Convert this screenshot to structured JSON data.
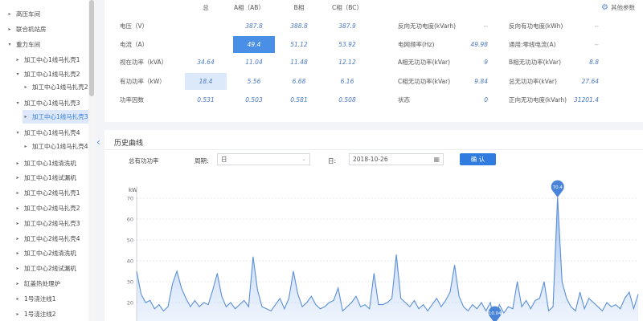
{
  "sidebar": {
    "items": [
      {
        "label": "高压车间",
        "arrow": "▸"
      },
      {
        "label": "联合机站房",
        "arrow": "▸"
      },
      {
        "label": "重力车间",
        "arrow": "▾"
      },
      {
        "label": "加工中心1线马扎壳1",
        "arrow": "▸"
      },
      {
        "label": "加工中心1线马扎壳2",
        "arrow": "▾"
      },
      {
        "label": "加工中心1线马扎壳2",
        "arrow": "▸"
      },
      {
        "label": "加工中心1线马扎壳3",
        "arrow": "▾"
      },
      {
        "label": "加工中心1线马扎壳3",
        "arrow": "▸"
      },
      {
        "label": "加工中心1线马扎壳4",
        "arrow": "▾"
      },
      {
        "label": "加工中心1线马扎壳4",
        "arrow": "▸"
      },
      {
        "label": "加工中心1线清洗机",
        "arrow": "▸"
      },
      {
        "label": "加工中心1线试漏机",
        "arrow": "▸"
      },
      {
        "label": "加工中心2线马扎壳1",
        "arrow": "▸"
      },
      {
        "label": "加工中心2线马扎壳2",
        "arrow": "▸"
      },
      {
        "label": "加工中心2线马扎壳3",
        "arrow": "▸"
      },
      {
        "label": "加工中心2线马扎壳4",
        "arrow": "▸"
      },
      {
        "label": "加工中心2线清洗机",
        "arrow": "▸"
      },
      {
        "label": "加工中心2线试漏机",
        "arrow": "▸"
      },
      {
        "label": "缸盖热处理炉",
        "arrow": "▸"
      },
      {
        "label": "1号浇注线1",
        "arrow": "▸"
      },
      {
        "label": "1号浇注线2",
        "arrow": "▸"
      }
    ]
  },
  "top": {
    "other_params": "其他参数",
    "headers": [
      "总",
      "A相（AB）",
      "B相",
      "C相（BC）"
    ],
    "rows": [
      {
        "label": "电压（V）",
        "values": [
          "",
          "387.8",
          "388.8",
          "387.9"
        ]
      },
      {
        "label": "电流（A）",
        "values": [
          "",
          "49.4",
          "51.12",
          "53.92"
        ]
      },
      {
        "label": "视在功率（kVA）",
        "values": [
          "34.64",
          "11.04",
          "11.48",
          "12.12"
        ]
      },
      {
        "label": "有功功率（kW）",
        "values": [
          "18.4",
          "5.56",
          "6.68",
          "6.16"
        ]
      },
      {
        "label": "功率因数",
        "values": [
          "0.531",
          "0.503",
          "0.581",
          "0.508"
        ]
      }
    ],
    "mid": [
      {
        "label": "反向无功电度(kVarh)",
        "value": "--"
      },
      {
        "label": "电网频率(Hz)",
        "value": "49.98"
      },
      {
        "label": "A相无功功率(kVar)",
        "value": "9"
      },
      {
        "label": "C相无功功率(kVar)",
        "value": "9.84"
      },
      {
        "label": "状态",
        "value": "0"
      }
    ],
    "right": [
      {
        "label": "反向有功电度(kWh)",
        "value": "--"
      },
      {
        "label": "通用:零线电流(A)",
        "value": "--"
      },
      {
        "label": "B相无功功率(kVar)",
        "value": "8.8"
      },
      {
        "label": "总无功功率(kVar)",
        "value": "27.64"
      },
      {
        "label": "正向无功电度(kVarh)",
        "value": "31201.4"
      }
    ]
  },
  "history": {
    "title": "历史曲线",
    "metric": "总有功功率",
    "period_label": "周期:",
    "period_value": "日",
    "date_label": "日:",
    "date_value": "2018-10-26",
    "confirm": "确 认"
  },
  "chart_data": {
    "type": "area",
    "ylabel": "kW",
    "yticks": [
      "70",
      "60",
      "50",
      "40",
      "30",
      "20"
    ],
    "ylim": [
      14,
      75
    ],
    "max_label": "70.4",
    "min_label": "10.04",
    "values": [
      35,
      24,
      20,
      21,
      17,
      19,
      16,
      18,
      29,
      35,
      27,
      22,
      18,
      21,
      18,
      20,
      19,
      26,
      34,
      23,
      18,
      20,
      17,
      19,
      21,
      18,
      42,
      26,
      18,
      17,
      16,
      19,
      22,
      17,
      22,
      35,
      24,
      18,
      20,
      23,
      19,
      17,
      18,
      20,
      21,
      27,
      16,
      18,
      20,
      23,
      18,
      19,
      17,
      34,
      19,
      19,
      20,
      22,
      43,
      22,
      20,
      18,
      21,
      17,
      19,
      16,
      19,
      22,
      18,
      21,
      25,
      38,
      23,
      18,
      16,
      19,
      17,
      20,
      16,
      20,
      10.04,
      19,
      15,
      18,
      17,
      30,
      18,
      21,
      17,
      21,
      22,
      30,
      16,
      18,
      70.4,
      30,
      22,
      18,
      16,
      25,
      17,
      22,
      20,
      18,
      16,
      20,
      18,
      19,
      17,
      22,
      25,
      17,
      24
    ]
  }
}
